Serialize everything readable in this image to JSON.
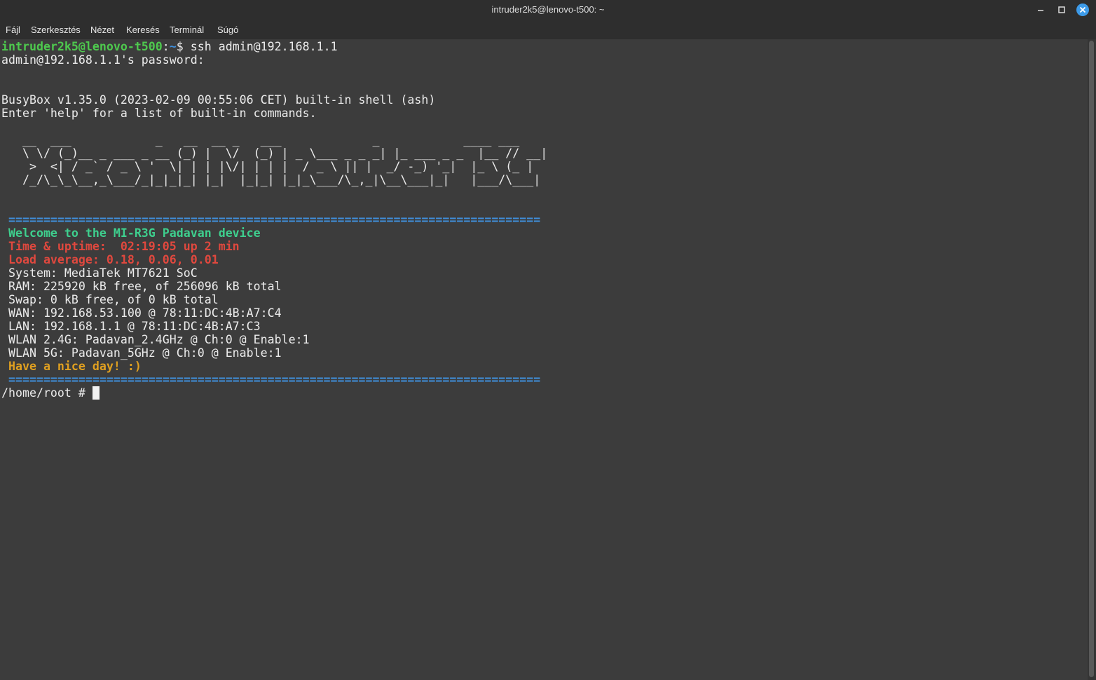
{
  "window": {
    "title": "intruder2k5@lenovo-t500: ~"
  },
  "menu": {
    "items": [
      "Fájl",
      "Szerkesztés",
      "Nézet",
      "Keresés",
      "Terminál",
      "Súgó"
    ]
  },
  "terminal": {
    "prompt_user": "intruder2k5@lenovo-t500",
    "prompt_sep": ":",
    "prompt_dir": "~",
    "prompt_sym": "$ ",
    "command": "ssh admin@192.168.1.1",
    "password_prompt": "admin@192.168.1.1's password: ",
    "busybox_line": "BusyBox v1.35.0 (2023-02-09 00:55:06 CET) built-in shell (ash)",
    "help_line": "Enter 'help' for a list of built-in commands.",
    "banner": [
      "   __  ___            _   __  __ _   ___             _            ____ ___ ",
      "   \\ \\/ (_)__ _ ___ _ __ (_) |  \\/  (_) | _ \\___ _ _ _| |_ ___ _ _  |__ // __|",
      "    >  <| / _` / _ \\ '  \\| | | |\\/| | | |  / _ \\ || |  _/ -_) '_|  |_ \\ (_ |",
      "   /_/\\_\\_\\__,_\\___/_|_|_|_| |_|  |_|_| |_|_\\___/\\_,_|\\__\\___|_|   |___/\\___|"
    ],
    "separator": " ============================================================================",
    "welcome": " Welcome to the MI-R3G Padavan device",
    "uptime": " Time & uptime:  02:19:05 up 2 min",
    "load": " Load average: 0.18, 0.06, 0.01",
    "system": " System: MediaTek MT7621 SoC",
    "ram": " RAM: 225920 kB free, of 256096 kB total",
    "swap": " Swap: 0 kB free, of 0 kB total",
    "wan": " WAN: 192.168.53.100 @ 78:11:DC:4B:A7:C4",
    "lan": " LAN: 192.168.1.1 @ 78:11:DC:4B:A7:C3",
    "wlan24": " WLAN 2.4G: Padavan_2.4GHz @ Ch:0 @ Enable:1",
    "wlan5": " WLAN 5G: Padavan_5GHz @ Ch:0 @ Enable:1",
    "goodbye": " Have a nice day! :)",
    "shell_prompt": "/home/root # "
  },
  "colors": {
    "background": "#3c3c3c",
    "titlebar": "#2e2e2e",
    "close_button": "#3d9be9"
  },
  "icons": {
    "minimize": "minimize-icon",
    "maximize": "maximize-icon",
    "close": "close-icon"
  }
}
